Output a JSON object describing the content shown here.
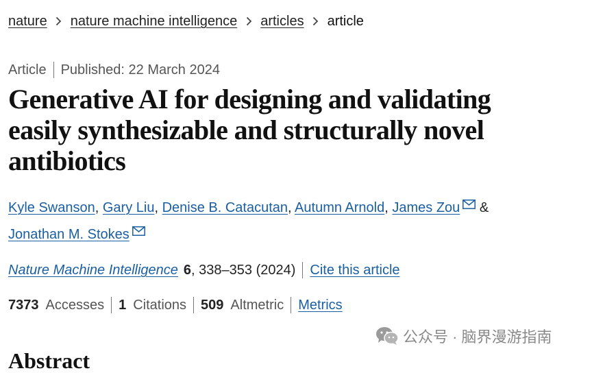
{
  "breadcrumb": {
    "items": [
      "nature",
      "nature machine intelligence",
      "articles"
    ],
    "current": "article"
  },
  "article": {
    "type": "Article",
    "published": "Published: 22 March 2024",
    "title": "Generative AI for designing and validating easily synthesizable and structurally novel antibiotics"
  },
  "authors": {
    "names": [
      "Kyle Swanson",
      "Gary Liu",
      "Denise B. Catacutan",
      "Autumn Arnold",
      "James Zou",
      "Jonathan M. Stokes"
    ],
    "separator": ",",
    "ampersand": "&",
    "colors": {
      "link": "#1a5fa3"
    }
  },
  "citation": {
    "journal": "Nature Machine Intelligence",
    "volume": "6",
    "pages_year": ", 338–353 (2024)",
    "cite_link": "Cite this article"
  },
  "metrics": {
    "accesses_count": "7373",
    "accesses_label": "Accesses",
    "citations_count": "1",
    "citations_label": "Citations",
    "altmetric_count": "509",
    "altmetric_label": "Altmetric",
    "metrics_link": "Metrics"
  },
  "section": {
    "abstract_heading": "Abstract"
  },
  "watermark": {
    "text": "公众号 · 脑界漫游指南",
    "icon": "wechat-icon"
  }
}
